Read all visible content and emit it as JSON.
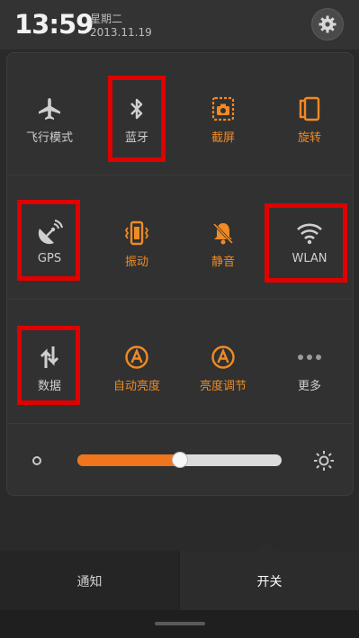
{
  "status": {
    "time": "13:59",
    "weekday": "星期二",
    "date": "2013.11.19"
  },
  "tiles": {
    "airplane": "飞行模式",
    "bluetooth": "蓝牙",
    "screenshot": "截屏",
    "rotate": "旋转",
    "gps": "GPS",
    "vibrate": "振动",
    "mute": "静音",
    "wlan": "WLAN",
    "data": "数据",
    "auto_brightness": "自动亮度",
    "brightness_adjust": "亮度调节",
    "more": "更多"
  },
  "brightness": {
    "level": 0.5
  },
  "tabs": {
    "notifications": "通知",
    "toggles": "开关"
  },
  "colors": {
    "accent": "#f08a24",
    "highlight": "#e00000",
    "inactive": "#cfcfcf"
  }
}
